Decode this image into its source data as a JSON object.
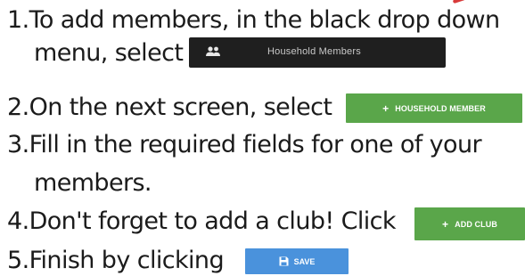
{
  "steps": [
    {
      "number": "1.",
      "text": "To add members, in the black drop down"
    },
    {
      "number": "",
      "text": "menu, select"
    },
    {
      "number": "2.",
      "text": "On the next screen, select"
    },
    {
      "number": "3.",
      "text": "Fill in the required fields for one of your"
    },
    {
      "number": "",
      "text": "members."
    },
    {
      "number": "4.",
      "text": "Don't forget to add a club! Click"
    },
    {
      "number": "5.",
      "text": "Finish by clicking"
    }
  ],
  "buttons": {
    "household_members": {
      "label": "Household Members",
      "icon": "people-icon",
      "color": "#1f1f1f"
    },
    "add_household_member": {
      "plus": "+",
      "label": "HOUSEHOLD MEMBER",
      "color": "#5aa64a"
    },
    "add_club": {
      "plus": "+",
      "label": "ADD CLUB",
      "color": "#5aa64a"
    },
    "save": {
      "label": "SAVE",
      "icon": "floppy-disk-icon",
      "color": "#4a92dc"
    }
  },
  "accent_mark_color": "#d83a3a"
}
